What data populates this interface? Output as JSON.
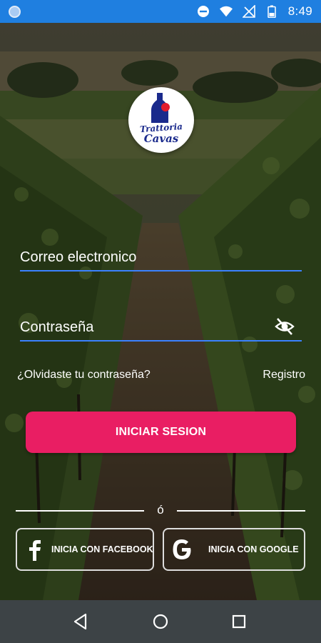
{
  "status_bar": {
    "time": "8:49",
    "icons": [
      "circle-indicator-icon",
      "do-not-disturb-icon",
      "wifi-icon",
      "no-signal-icon",
      "battery-icon"
    ]
  },
  "logo": {
    "line1": "Trattoria",
    "line2": "Cavas"
  },
  "login_form": {
    "email_placeholder": "Correo electronico",
    "password_placeholder": "Contraseña",
    "forgot_password": "¿Olvidaste tu contraseña?",
    "register": "Registro",
    "login_button": "INICIAR SESION"
  },
  "divider": {
    "text": "ó"
  },
  "social": {
    "facebook_label": "INICIA CON FACEBOOK",
    "google_label": "INICIA CON GOOGLE"
  },
  "colors": {
    "status_bar": "#1f7fe0",
    "accent_underline": "#3b82ff",
    "login_button": "#e91e63",
    "nav_bar": "#3d4346",
    "logo_text": "#1a2a8c"
  },
  "nav_bar": {
    "icons": [
      "back-icon",
      "home-icon",
      "recents-icon"
    ]
  }
}
